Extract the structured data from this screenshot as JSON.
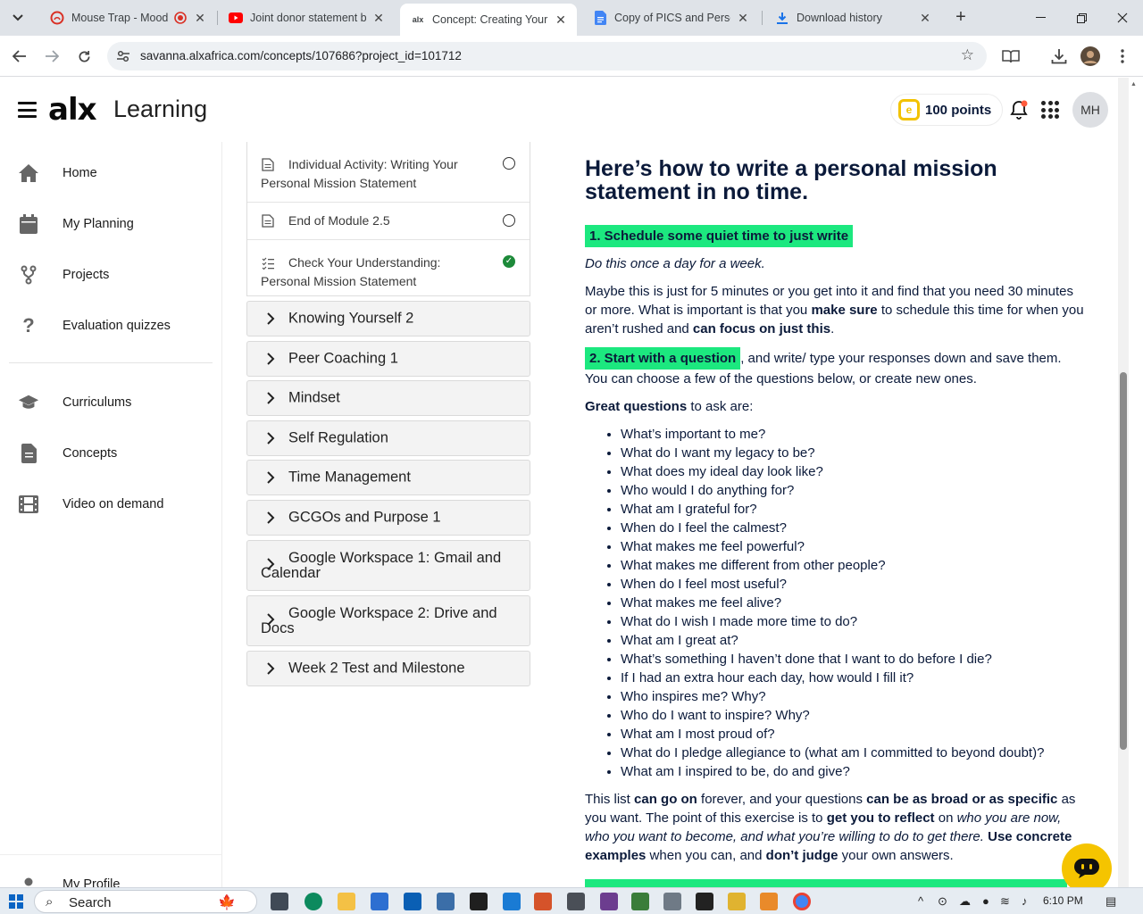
{
  "browser": {
    "tabs": [
      {
        "title": "Mouse Trap - Moody",
        "active": false
      },
      {
        "title": "Joint donor statement by",
        "active": false
      },
      {
        "title": "Concept: Creating Your P",
        "active": true
      },
      {
        "title": "Copy of PICS and Person",
        "active": false
      },
      {
        "title": "Download history",
        "active": false
      }
    ],
    "url": "savanna.alxafrica.com/concepts/107686?project_id=101712"
  },
  "app": {
    "logo": "alx",
    "logo_sub": "Learning",
    "points": "100 points",
    "avatar_initials": "MH"
  },
  "sidebar": {
    "items": [
      {
        "label": "Home",
        "icon": "home-icon"
      },
      {
        "label": "My Planning",
        "icon": "calendar-icon"
      },
      {
        "label": "Projects",
        "icon": "fork-icon"
      },
      {
        "label": "Evaluation quizzes",
        "icon": "question-icon"
      },
      {
        "label": "Curriculums",
        "icon": "mortarboard-icon"
      },
      {
        "label": "Concepts",
        "icon": "document-icon"
      },
      {
        "label": "Video on demand",
        "icon": "film-icon"
      }
    ],
    "profile": "My Profile"
  },
  "module_panel": {
    "sub_items": [
      {
        "label": "Individual Activity: Writing Your Personal Mission Statement",
        "status": "open"
      },
      {
        "label": "End of Module 2.5",
        "status": "open"
      },
      {
        "label": "Check Your Understanding: Personal Mission Statement",
        "status": "done"
      }
    ],
    "modules": [
      "Knowing Yourself 2",
      "Peer Coaching 1",
      "Mindset",
      "Self Regulation",
      "Time Management",
      "GCGOs and Purpose 1",
      "Google Workspace 1: Gmail and Calendar",
      "Google Workspace 2: Drive and Docs",
      "Week 2 Test and Milestone"
    ]
  },
  "content": {
    "heading": "Here’s how to write a personal mission statement in no time.",
    "step1": "1. Schedule some quiet time to just write",
    "step1_italic": "Do this once a day for a week.",
    "p1_a": "Maybe this is just for 5 minutes or you get into it and find that you need 30 minutes or more. What is important is that you ",
    "p1_b": "make sure",
    "p1_c": " to schedule this time for when you aren’t rushed and ",
    "p1_d": "can focus on just this",
    "p1_e": ".",
    "step2": "2. Start with a question",
    "step2_rest": ", and write/ type your responses down and save them. You can choose a few of the questions below, or create new ones.",
    "gq_bold": "Great questions",
    "gq_rest": " to ask are:",
    "questions": [
      "What’s important to me?",
      "What do I want my legacy to be?",
      "What does my ideal day look like?",
      "Who would I do anything for?",
      "What am I grateful for?",
      "When do I feel the calmest?",
      "What makes me feel powerful?",
      "What makes me different from other people?",
      "When do I feel most useful?",
      "What makes me feel alive?",
      "What do I wish I made more time to do?",
      "What am I great at?",
      "What’s something I haven’t done that I want to do before I die?",
      "If I had an extra hour each day, how would I fill it?",
      "Who inspires me? Why?",
      "Who do I want to inspire? Why?",
      "What am I most proud of?",
      "What do I pledge allegiance to (what am I committed to beyond doubt)?",
      "What am I inspired to be, do and give?"
    ],
    "p3_a": "This list ",
    "p3_b": "can go on",
    "p3_c": " forever, and your questions ",
    "p3_d": "can be as broad or as specific",
    "p3_e": " as you want. The point of this exercise is to ",
    "p3_f": "get you to reflect",
    "p3_g": " on ",
    "p3_h": "who you are now, who you want to become, and what you’re willing to do to get there.",
    "p3_i": " ",
    "p3_j": "Use concrete examples",
    "p3_k": " when you can, and ",
    "p3_l": "don’t judge",
    "p3_m": " your own answers."
  },
  "taskbar": {
    "search": "Search",
    "time": "6:10 PM"
  },
  "colors": {
    "highlight": "#1ce87f",
    "heading": "#0b1a3a",
    "chatbot": "#f5c400",
    "done": "#1d8a3a"
  }
}
